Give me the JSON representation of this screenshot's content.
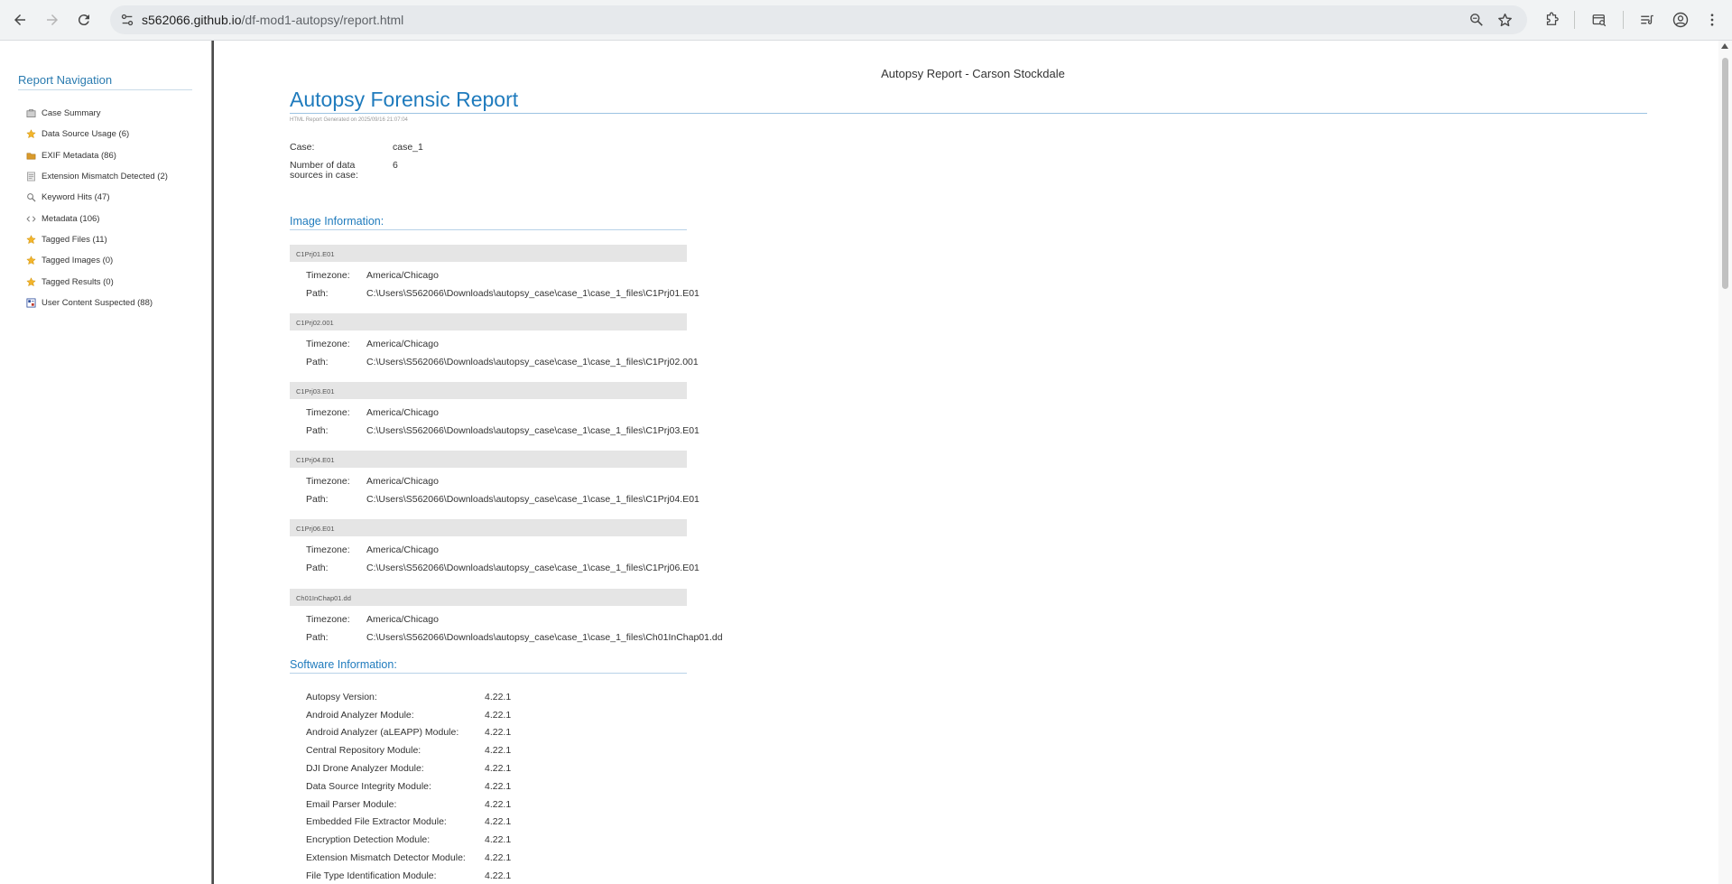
{
  "browser": {
    "url_host": "s562066.github.io",
    "url_path": "/df-mod1-autopsy/report.html"
  },
  "nav": {
    "title": "Report Navigation",
    "items": [
      {
        "label": "Case Summary",
        "icon": "case-summary-icon"
      },
      {
        "label": "Data Source Usage (6)",
        "icon": "star-icon"
      },
      {
        "label": "EXIF Metadata (86)",
        "icon": "folder-icon"
      },
      {
        "label": "Extension Mismatch Detected (2)",
        "icon": "mismatch-icon"
      },
      {
        "label": "Keyword Hits (47)",
        "icon": "magnifier-icon"
      },
      {
        "label": "Metadata (106)",
        "icon": "code-icon"
      },
      {
        "label": "Tagged Files (11)",
        "icon": "star-icon"
      },
      {
        "label": "Tagged Images (0)",
        "icon": "star-icon"
      },
      {
        "label": "Tagged Results (0)",
        "icon": "star-icon"
      },
      {
        "label": "User Content Suspected (88)",
        "icon": "user-content-icon"
      }
    ]
  },
  "report": {
    "header": "Autopsy Report - Carson Stockdale",
    "title": "Autopsy Forensic Report",
    "generated": "HTML Report Generated on 2025/09/16 21:07:04",
    "case_label": "Case:",
    "case_value": "case_1",
    "sources_label": "Number of data sources in case:",
    "sources_value": "6"
  },
  "image_info": {
    "title": "Image Information:",
    "timezone_label": "Timezone:",
    "path_label": "Path:",
    "images": [
      {
        "name": "C1Prj01.E01",
        "timezone": "America/Chicago",
        "path": "C:\\Users\\S562066\\Downloads\\autopsy_case\\case_1\\case_1_files\\C1Prj01.E01"
      },
      {
        "name": "C1Prj02.001",
        "timezone": "America/Chicago",
        "path": "C:\\Users\\S562066\\Downloads\\autopsy_case\\case_1\\case_1_files\\C1Prj02.001"
      },
      {
        "name": "C1Prj03.E01",
        "timezone": "America/Chicago",
        "path": "C:\\Users\\S562066\\Downloads\\autopsy_case\\case_1\\case_1_files\\C1Prj03.E01"
      },
      {
        "name": "C1Prj04.E01",
        "timezone": "America/Chicago",
        "path": "C:\\Users\\S562066\\Downloads\\autopsy_case\\case_1\\case_1_files\\C1Prj04.E01"
      },
      {
        "name": "C1Prj06.E01",
        "timezone": "America/Chicago",
        "path": "C:\\Users\\S562066\\Downloads\\autopsy_case\\case_1\\case_1_files\\C1Prj06.E01"
      },
      {
        "name": "Ch01InChap01.dd",
        "timezone": "America/Chicago",
        "path": "C:\\Users\\S562066\\Downloads\\autopsy_case\\case_1\\case_1_files\\Ch01InChap01.dd"
      }
    ]
  },
  "software_info": {
    "title": "Software Information:",
    "rows": [
      {
        "label": "Autopsy Version:",
        "value": "4.22.1"
      },
      {
        "label": "Android Analyzer Module:",
        "value": "4.22.1"
      },
      {
        "label": "Android Analyzer (aLEAPP) Module:",
        "value": "4.22.1"
      },
      {
        "label": "Central Repository Module:",
        "value": "4.22.1"
      },
      {
        "label": "DJI Drone Analyzer Module:",
        "value": "4.22.1"
      },
      {
        "label": "Data Source Integrity Module:",
        "value": "4.22.1"
      },
      {
        "label": "Email Parser Module:",
        "value": "4.22.1"
      },
      {
        "label": "Embedded File Extractor Module:",
        "value": "4.22.1"
      },
      {
        "label": "Encryption Detection Module:",
        "value": "4.22.1"
      },
      {
        "label": "Extension Mismatch Detector Module:",
        "value": "4.22.1"
      },
      {
        "label": "File Type Identification Module:",
        "value": "4.22.1"
      }
    ]
  }
}
